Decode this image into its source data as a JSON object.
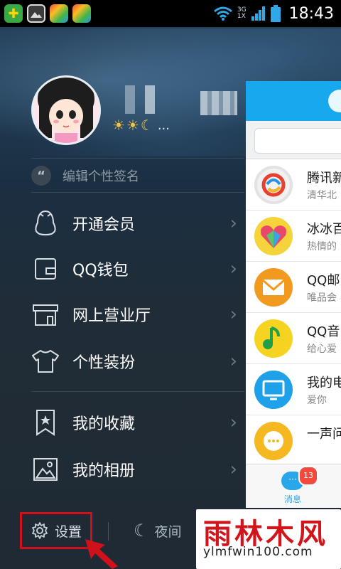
{
  "status_bar": {
    "time": "18:43",
    "network_top": "3G",
    "network_bottom": "1X"
  },
  "profile": {
    "level_icons": [
      "sun-icon",
      "sun-icon",
      "moon-icon"
    ],
    "level_more": "..."
  },
  "signature": {
    "quote_glyph": "“",
    "text": "编辑个性签名"
  },
  "menu": {
    "items": [
      {
        "label": "开通会员",
        "icon": "penguin-icon"
      },
      {
        "label": "QQ钱包",
        "icon": "wallet-icon"
      },
      {
        "label": "网上营业厅",
        "icon": "store-icon"
      },
      {
        "label": "个性装扮",
        "icon": "tshirt-icon"
      },
      {
        "label": "我的收藏",
        "icon": "bookmark-star-icon"
      },
      {
        "label": "我的相册",
        "icon": "photo-album-icon"
      }
    ]
  },
  "bottom": {
    "settings_label": "设置",
    "night_label": "夜间"
  },
  "main_panel": {
    "conversations": [
      {
        "title": "腾讯新",
        "subtitle": "清华北",
        "color": "#e8402f"
      },
      {
        "title": "冰冰百",
        "subtitle": "热情的",
        "color": "#f2c230"
      },
      {
        "title": "QQ邮",
        "subtitle": "唯品会",
        "color": "#f29a1e"
      },
      {
        "title": "QQ音",
        "subtitle": "给心爱",
        "color": "#f6d321"
      },
      {
        "title": "我的电",
        "subtitle": "爱你",
        "color": "#1ea1e8"
      },
      {
        "title": "一声问",
        "subtitle": "",
        "color": "#f6b820"
      }
    ],
    "tab_label": "消息",
    "badge_count": "13"
  },
  "watermark": {
    "title": "雨林木风",
    "url": "ylmfwin100.com"
  },
  "colors": {
    "qq_blue": "#18a8ee",
    "highlight_red": "#d0101a"
  }
}
